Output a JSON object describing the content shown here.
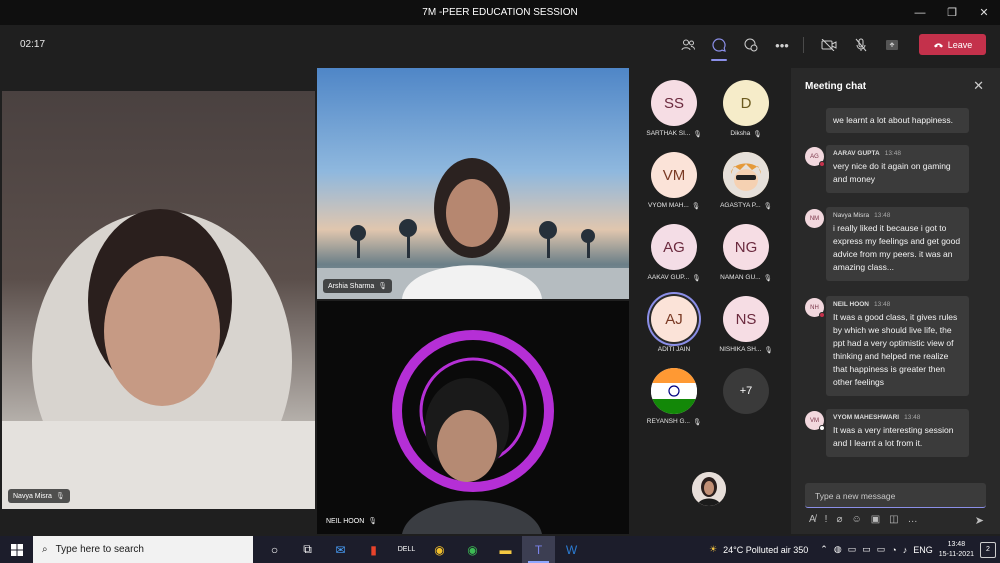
{
  "window": {
    "title": "7M -PEER EDUCATION SESSION"
  },
  "meeting": {
    "timer": "02:17",
    "leave_label": "Leave",
    "toolbar_icons": [
      "participants-icon",
      "chat-icon",
      "reactions-icon",
      "more-icon",
      "camera-off-icon",
      "mic-off-icon",
      "share-icon"
    ]
  },
  "videos": {
    "navya": {
      "name": "Navya Misra"
    },
    "arshia": {
      "name": "Arshia Sharma"
    },
    "neil": {
      "name": "NEIL HOON"
    }
  },
  "participants": [
    {
      "initials": "SS",
      "name": "SARTHAK SI...",
      "color": "#f6dde4"
    },
    {
      "initials": "D",
      "name": "Diksha",
      "color": "#f6ecc9"
    },
    {
      "initials": "VM",
      "name": "VYOM MAH...",
      "color": "#fbe3d8"
    },
    {
      "initials": "",
      "name": "AGASTYA P...",
      "color": "#f0c27a"
    },
    {
      "initials": "AG",
      "name": "AAKAV GUP...",
      "color": "#f4dde6"
    },
    {
      "initials": "NG",
      "name": "NAMAN GU...",
      "color": "#f6dde4"
    },
    {
      "initials": "AJ",
      "name": "ADITI JAIN",
      "color": "#fbe3d8"
    },
    {
      "initials": "NS",
      "name": "NISHIKA SH...",
      "color": "#f6dde4"
    },
    {
      "initials": "",
      "name": "REYANSH G...",
      "color": "#ffffff"
    },
    {
      "initials": "+7",
      "name": "",
      "color": "#3a3a3a"
    }
  ],
  "chat": {
    "title": "Meeting chat",
    "compose_placeholder": "Type a new message",
    "messages": [
      {
        "initials": "",
        "author": "",
        "time": "",
        "text": "we learnt a lot about happiness."
      },
      {
        "initials": "AG",
        "author": "AARAV GUPTA",
        "time": "13:48",
        "text": "very nice do it again on gaming and money"
      },
      {
        "initials": "NM",
        "author": "Navya Misra",
        "time": "13:48",
        "text": "i really liked it because i got to express my feelings and get good advice from my peers. it was an amazing class..."
      },
      {
        "initials": "NH",
        "author": "NEIL HOON",
        "time": "13:48",
        "text": "It was a good class, it gives rules by which we should live life, the ppt had a very optimistic view of thinking and helped me realize that happiness is greater then other feelings"
      },
      {
        "initials": "VM",
        "author": "VYOM MAHESHWARI",
        "time": "13:48",
        "text": "It was a very interesting session and I learnt a lot from it."
      }
    ]
  },
  "taskbar": {
    "search_placeholder": "Type here to search",
    "weather": "24°C  Polluted air 350",
    "lang": "ENG",
    "time": "13:48",
    "date": "15-11-2021",
    "notifications": "2"
  }
}
